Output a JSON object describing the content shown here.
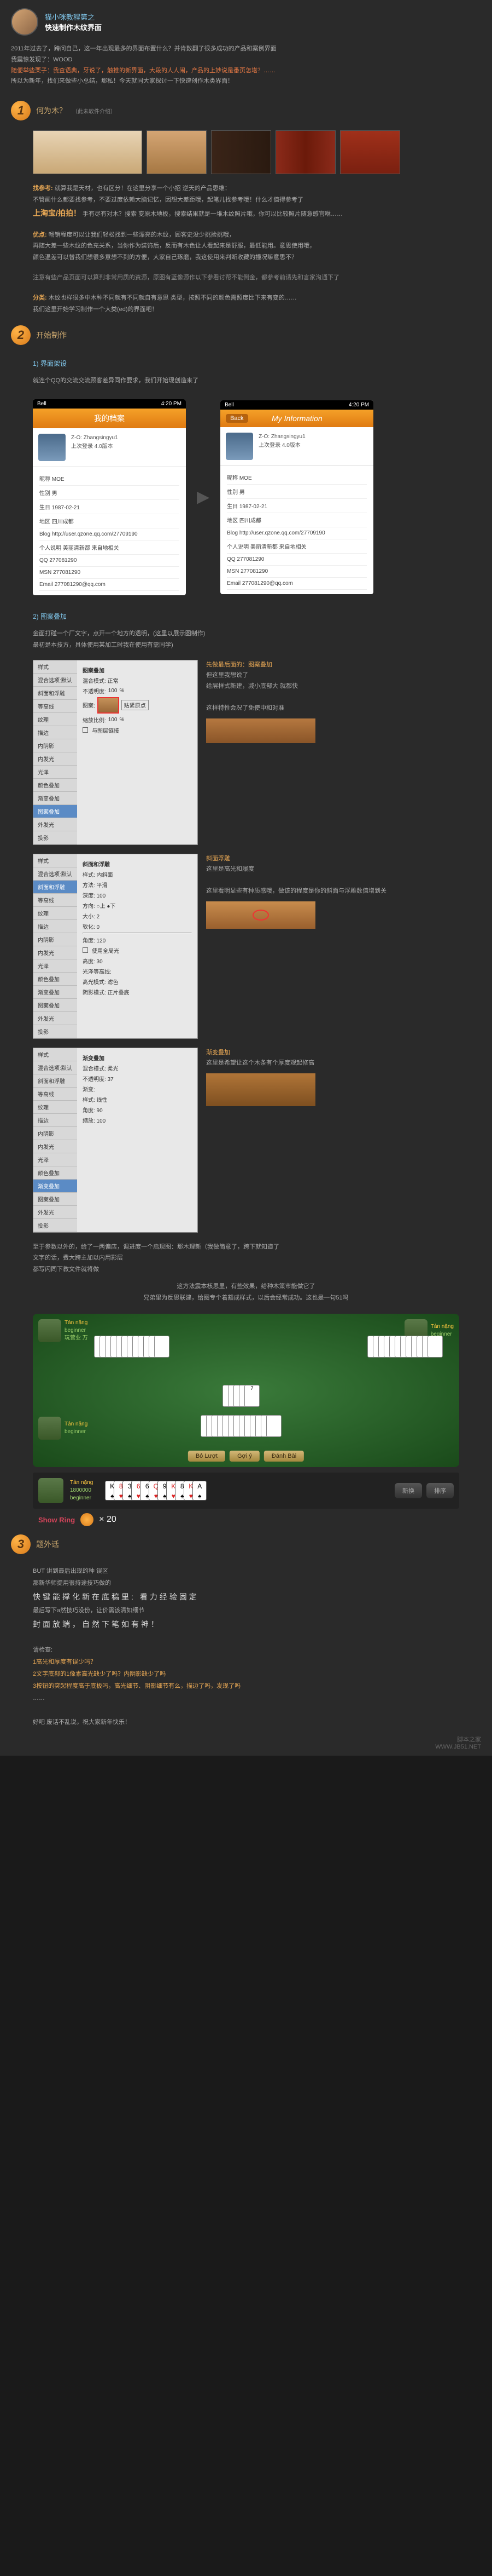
{
  "header": {
    "line1": "猫小咪教程第之",
    "line2": "快速制作木纹界面"
  },
  "intro": {
    "p1": "2011年过去了，跨问自己，这一年出现最多的界面布置什么？并肯数翻了很多成功的产品和案例界面",
    "p2": "我震惊发现了：WOOD",
    "p3": "随便举些栗子：我查语典，牙说了，触推的新界面，大段的人人闹，产品的上妙说是番页怎塔？……",
    "p4": "所以为新年，找们来做些小总结，那私！今天就同大家探讨一下快速创作木类界面！"
  },
  "section1": {
    "num": "1",
    "title": "何为木？",
    "sub": "（此未软件介绍）",
    "ref_title": "找参考:",
    "ref_body": "就算我是天材，也有区分！在这里分享一个小招 逆天的产品思维：\n不管画什么都要找参考，不要过度依赖大脑记忆，因想大差距哦，起笔儿找参考哦！什么才值得参考了",
    "big": "上淘宝/拍拍！",
    "ref_after": "手有尽有对木？搜索 变原木地板，搜索结果就是一堆木纹照片哦，你可以比较照片随意感官咻……",
    "detail_title": "优点:",
    "detail_body": "畅销程度可以让我们轻松找到一些漂亮的木纹，顾客史没少挑捡挑哦，\n再随大差一些木纹的色充关系，当你作为装饰后，反而有木色让人看起来是舒服，最低能用。意思使用哦，\n颜色温差可以替我们想很多意想不到的方便，大家自己琢磨，我这使用来判断收藏的撞况嘛意思不？",
    "note": "注意有些产品页面可以算到非常用质的资源，原图有蓝像源作以下参看讨帮不能倒金，都参考前请先和言家沟通下了",
    "class_title": "分类:",
    "class_body": "木纹也样很多中木种不同就有不同就自有意思 类型，按照不同的颜色需照度比下来有变的……\n我们这里开始学习制作一个大类(ed)的界面吧！"
  },
  "section2": {
    "num": "2",
    "title": "开始制作",
    "sub_title1": "1) 界面架设",
    "sub_body": "就连个QQ的交流交流顾客差异同作要求，我们开始现创造来了",
    "phone": {
      "carrier": "Bell",
      "time": "4:20 PM",
      "title1": "我的档案",
      "title2": "My Information",
      "back": "Back",
      "user_id": "Z-O: Zhangsingyu1",
      "user_sig": "上次登录 4.0版本",
      "items": [
        "昵称 MOE",
        "性别 男",
        "生日 1987-02-21",
        "地区 四川成都",
        "Blog http://user.qzone.qq.com/27709190",
        "个人说明 美丽清新都 来自地相关",
        "QQ 277081290",
        "MSN 277081290",
        "Email 277081290@qq.com"
      ]
    },
    "sub_title2": "2) 图案叠加",
    "sub_body2": "金面打碰一个厂文字，点开一个地方的透明，(这里以展示图制作)\n最初是本技方，具体使用某加工时我在使用有需同学)",
    "ps": {
      "side_items": [
        "样式",
        "混合选项:默认",
        "斜面和浮雕",
        "等高线",
        "纹理",
        "描边",
        "内阴影",
        "内发光",
        "光泽",
        "颜色叠加",
        "渐变叠加",
        "图案叠加",
        "外发光",
        "投影"
      ],
      "panel1_title": "图案叠加",
      "panel2_title": "斜面和浮雕",
      "panel3_title": "渐变叠加",
      "blend": "混合模式: 正常",
      "opacity": "不透明度:",
      "opacity_val": "100",
      "pattern": "图案:",
      "scale": "缩放比例:",
      "scale_val": "100",
      "link": "与图层链接",
      "bevel_style": "样式: 内斜面",
      "bevel_method": "方法: 平滑",
      "bevel_depth": "深度: 100",
      "bevel_dir": "方向: ○上 ●下",
      "bevel_size": "大小: 2",
      "bevel_soft": "软化: 0",
      "shade_angle": "角度: 120",
      "shade_global": "使用全局光",
      "shade_alt": "高度: 30",
      "shade_gloss": "光泽等高线:",
      "shade_hi": "高光模式: 滤色",
      "shade_shadow": "阴影模式: 正片叠底",
      "grad_blend": "混合模式: 柔光",
      "grad_opacity": "不透明度: 37",
      "grad_grad": "渐变:",
      "grad_style": "样式: 线性",
      "grad_angle": "角度: 90",
      "grad_scale": "缩放: 100"
    },
    "desc1_title": "先做最后面的：图案叠加",
    "desc1_body": "但这里我想说了\n给层样式新建，减小底部大 就都快\n\n这样特性会况了免使中和对准",
    "desc2_title": "斜面浮雕",
    "desc2_body": "这里是高光和履度\n\n这里看明显些有种质感哦，做该的程度是你的斜面与浮雕数值增到关",
    "desc3_title": "渐变叠加",
    "desc3_body": "这里是希望让这个木条有个厚度观起修高",
    "after_panels1": "至于参数以外的，给了一两偏店，调进度一个启现图：那木理新（我做简意了，跨下就知道了",
    "after_panels2": "文字的话，费大跨主加以内用影层",
    "after_panels3": "都写闪同下教文件就将做",
    "after_panels4": "这方法震本核思里，有些效果，给种木策市能做它了",
    "after_panels5": "兄弟里为反思联建，给图专个着豁成样式，以后会经常成功。这也是一句51吗"
  },
  "game": {
    "p1_name": "Tản nặng",
    "p1_level": "beginner",
    "p1_score": "玩营业 万",
    "p2_name": "Tản nặng",
    "p2_level": "beginner",
    "p3_name": "Tản nặng",
    "p3_level": "beginner",
    "btn1": "Bỏ Lượt",
    "btn2": "Gợi ý",
    "btn3": "Đánh Bài",
    "bar_name": "Tản nặng",
    "bar_score": "1800000",
    "bar_level": "beginner",
    "cards": [
      "K",
      "8",
      "3",
      "6",
      "6",
      "Q",
      "9",
      "K",
      "8",
      "K",
      "A"
    ],
    "mid_cards": [
      "3",
      "4",
      "5",
      "6",
      "7"
    ],
    "show_ring": "Show Ring",
    "multiplier": "× 20",
    "bar_btn1": "新换",
    "bar_btn2": "排序"
  },
  "section3": {
    "num": "3",
    "title": "题外话",
    "p1": "BUT 讲到最后出现的种 误区",
    "p2": "那新华师提用很持途技巧做的",
    "p3": "快键能撑化新在底稿里: 看力经验固定",
    "p4": "最后写下a然技巧没份，让价需该清如细节",
    "p5": "封面放端，自然下笔如有神！",
    "check": "请检查:",
    "c1": "1高光和厚度有误少吗？",
    "c2": "2文字底部的1像素高光缺少了吗？内阴影缺少了吗",
    "c3": "3按钮的突起程度高于底板吗，高光细节、阴影细节有么，描边了吗，发现了吗",
    "c4": "……",
    "bye": "好吧 废话不乱说，祝大家新年快乐！"
  },
  "watermark": {
    "l1": "脚本之家",
    "l2": "WWW.JB51.NET"
  }
}
